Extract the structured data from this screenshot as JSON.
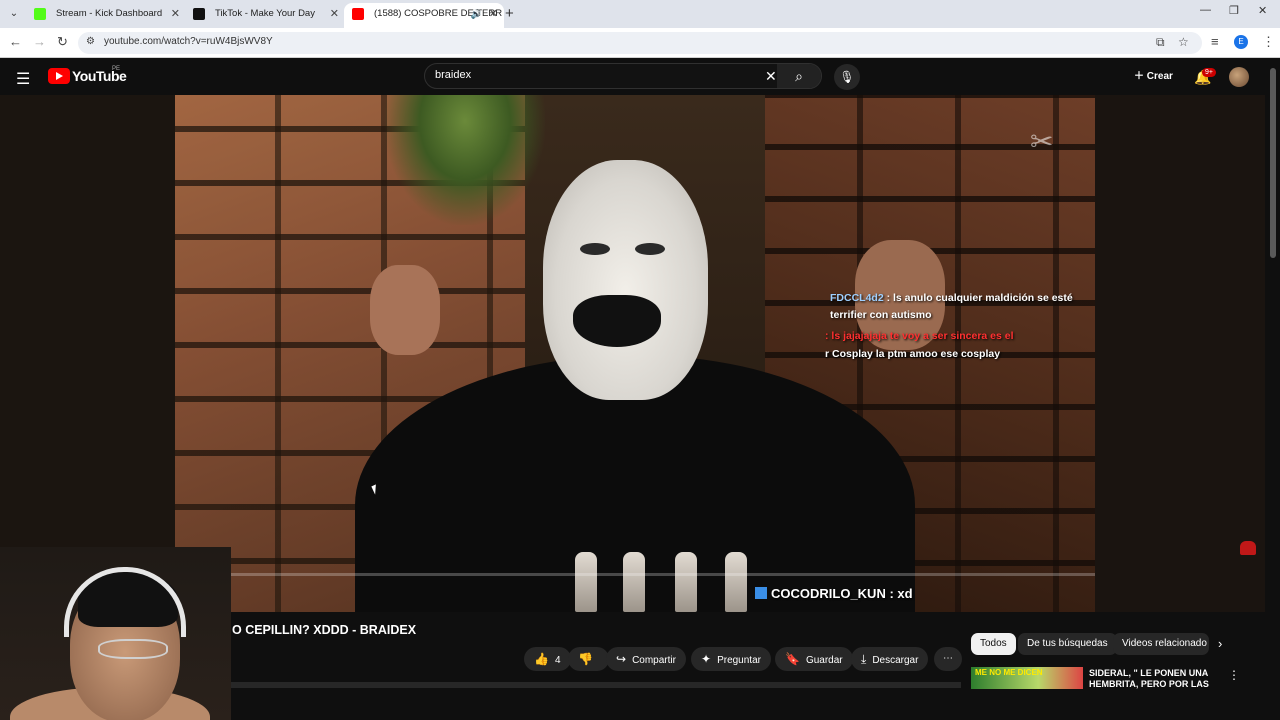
{
  "browser": {
    "tabs": [
      {
        "title": "Stream - Kick Dashboard",
        "fav_color": "#53fc18"
      },
      {
        "title": "TikTok - Make Your Day",
        "fav_color": "#111111"
      },
      {
        "title": "(1588) COSPOBRE DE TERR",
        "fav_color": "#ff0000"
      }
    ],
    "new_tab": "+",
    "url": "youtube.com/watch?v=ruW4BjsWV8Y",
    "profile_initial": "E"
  },
  "youtube": {
    "logo_text": "YouTube",
    "region": "PE",
    "search_query": "braidex",
    "create_label": "Crear",
    "notif_badge": "9+"
  },
  "player": {
    "chat_lines": [
      {
        "user": "FDCCL4d2",
        "text": ": ls anulo cualquier maldición se esté",
        "user_class": "user"
      },
      {
        "user": "",
        "text": "terrifier con autismo",
        "user_class": "user"
      },
      {
        "user": "",
        "text": ": ls jajajajaja te voy a ser sincera es el",
        "user_class": "user-red"
      },
      {
        "user": "",
        "text": "r Cosplay la ptm amoo ese cosplay",
        "user_class": "user"
      }
    ],
    "big_chat_user": "COCODRILO_KUN",
    "big_chat_text": ": xd"
  },
  "video": {
    "title": "O CEPILLIN? XDDD - BRAIDEX",
    "likes": "4",
    "actions": {
      "share": "Compartir",
      "ask": "Preguntar",
      "save": "Guardar",
      "download": "Descargar"
    }
  },
  "chips": [
    "Todos",
    "De tus búsquedas",
    "Videos relacionado"
  ],
  "recommended": {
    "thumb_text": "ME NO ME DICEN",
    "title": "SIDERAL, \" LE PONEN UNA HEMBRITA, PERO POR LAS"
  }
}
